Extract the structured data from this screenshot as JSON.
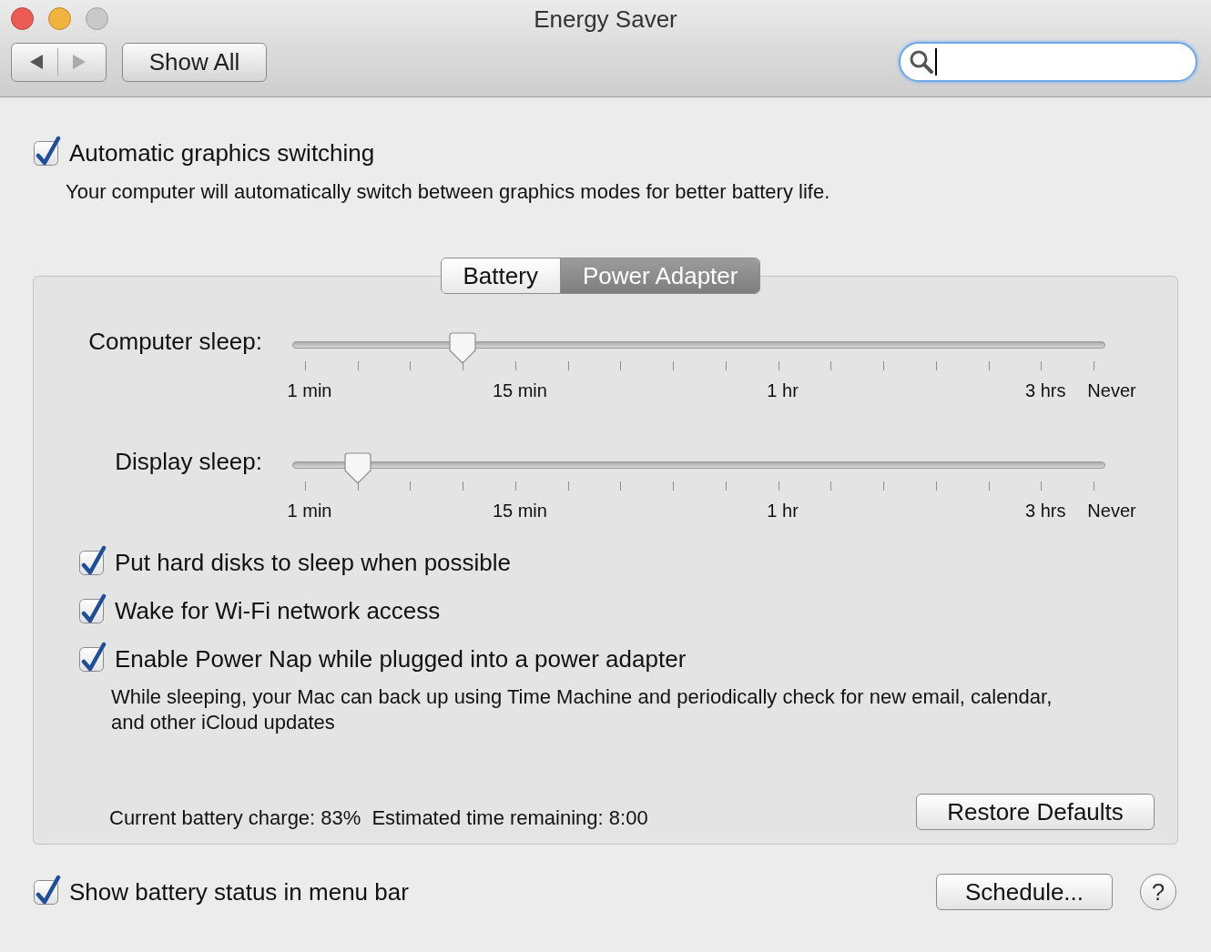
{
  "window": {
    "title": "Energy Saver"
  },
  "toolbar": {
    "show_all": "Show All"
  },
  "graphics_switching": {
    "label": "Automatic graphics switching",
    "checked": true,
    "description": "Your computer will automatically switch between graphics modes for better battery life."
  },
  "tabs": [
    {
      "label": "Battery",
      "selected": false
    },
    {
      "label": "Power Adapter",
      "selected": true
    }
  ],
  "sliders": [
    {
      "label": "Computer sleep:",
      "level": 0.2,
      "tick_labels": [
        "1 min",
        "15 min",
        "1 hr",
        "3 hrs",
        "Never"
      ]
    },
    {
      "label": "Display sleep:",
      "level": 0.0667,
      "tick_labels": [
        "1 min",
        "15 min",
        "1 hr",
        "3 hrs",
        "Never"
      ]
    }
  ],
  "options": [
    {
      "label": "Put hard disks to sleep when possible",
      "checked": true
    },
    {
      "label": "Wake for Wi-Fi network access",
      "checked": true
    },
    {
      "label": "Enable Power Nap while plugged into a power adapter",
      "checked": true,
      "description": "While sleeping, your Mac can back up using Time Machine and periodically check for new email, calendar, and other iCloud updates"
    }
  ],
  "battery_charge": "Current battery charge: 83%",
  "time_remaining": "Estimated time remaining: 8:00",
  "restore_button": "Restore Defaults",
  "show_battery_status": {
    "label": "Show battery status in menu bar",
    "checked": true
  },
  "schedule_button": "Schedule...",
  "help_button": "?"
}
